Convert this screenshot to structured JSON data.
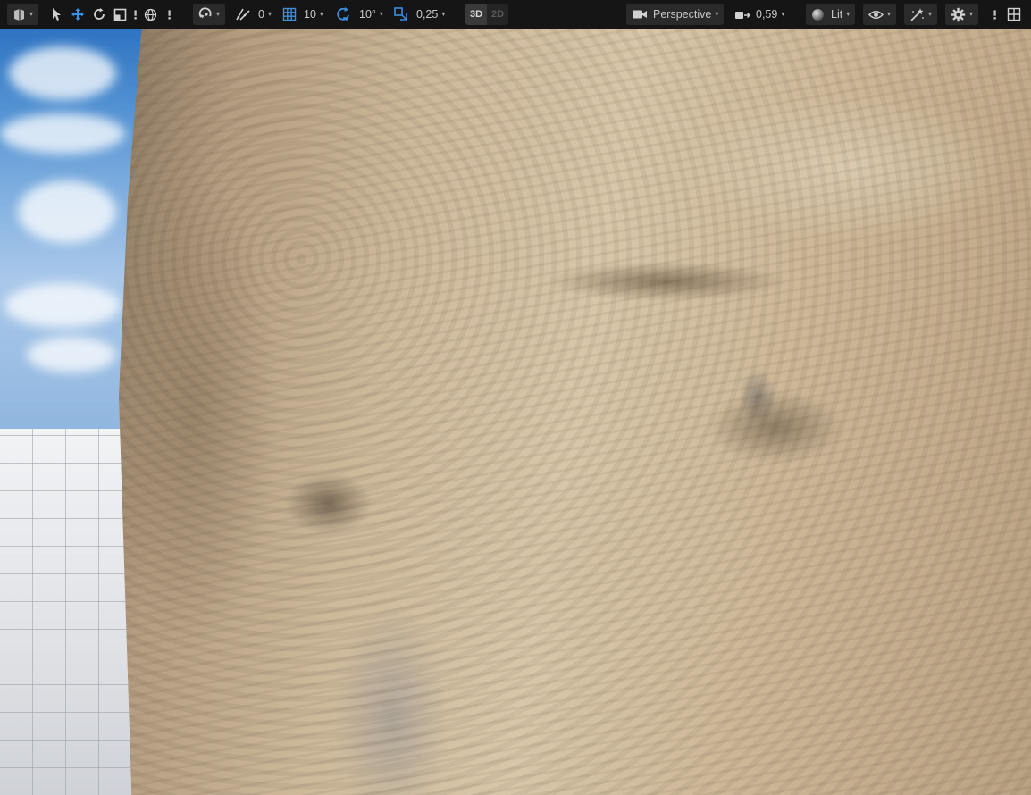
{
  "toolbar": {
    "snap_angle_value": "0",
    "grid_snap_value": "10",
    "rotation_snap_value": "10°",
    "scale_snap_value": "0,25",
    "mode_3d": "3D",
    "mode_2d": "2D",
    "view_mode_label": "Perspective",
    "camera_speed_value": "0,59",
    "lighting_mode_label": "Lit"
  },
  "colors": {
    "accent_blue": "#3a8fe0",
    "toolbar_bg": "#151515",
    "sky": "#7eaedf",
    "floor": "#dfe1e5",
    "wall": "#cdb89a"
  },
  "icons": [
    "perspective-view-icon",
    "select-arrow-icon",
    "move-gizmo-icon",
    "rotate-icon",
    "scale-icon",
    "world-space-icon",
    "surface-snap-icon",
    "angle-snap-icon",
    "grid-snap-icon",
    "rotation-snap-icon",
    "scale-snap-icon",
    "camera-icon",
    "camera-speed-icon",
    "lit-sphere-icon",
    "eye-icon",
    "show-flags-icon",
    "settings-gear-icon",
    "layout-grid-icon"
  ]
}
